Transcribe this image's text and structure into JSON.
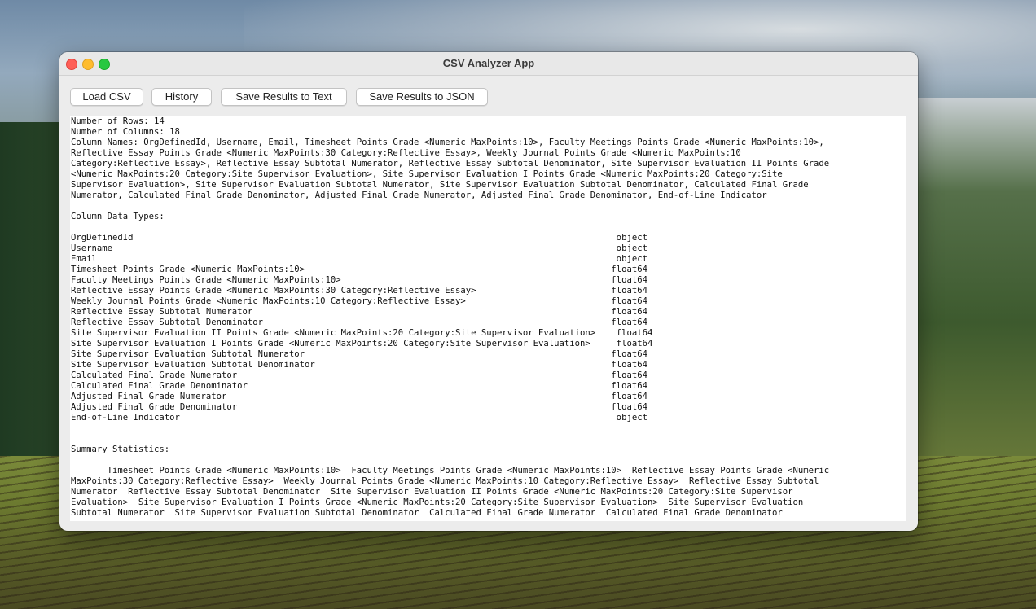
{
  "window": {
    "title": "CSV Analyzer App",
    "controls": {
      "close": "close-icon",
      "minimize": "minimize-icon",
      "maximize": "maximize-icon"
    }
  },
  "toolbar": {
    "load_csv": "Load CSV",
    "history": "History",
    "save_text": "Save Results to Text",
    "save_json": "Save Results to JSON"
  },
  "output_text": "Number of Rows: 14\nNumber of Columns: 18\nColumn Names: OrgDefinedId, Username, Email, Timesheet Points Grade <Numeric MaxPoints:10>, Faculty Meetings Points Grade <Numeric MaxPoints:10>,\nReflective Essay Points Grade <Numeric MaxPoints:30 Category:Reflective Essay>, Weekly Journal Points Grade <Numeric MaxPoints:10\nCategory:Reflective Essay>, Reflective Essay Subtotal Numerator, Reflective Essay Subtotal Denominator, Site Supervisor Evaluation II Points Grade\n<Numeric MaxPoints:20 Category:Site Supervisor Evaluation>, Site Supervisor Evaluation I Points Grade <Numeric MaxPoints:20 Category:Site\nSupervisor Evaluation>, Site Supervisor Evaluation Subtotal Numerator, Site Supervisor Evaluation Subtotal Denominator, Calculated Final Grade\nNumerator, Calculated Final Grade Denominator, Adjusted Final Grade Numerator, Adjusted Final Grade Denominator, End-of-Line Indicator\n\nColumn Data Types:\n\nOrgDefinedId                                                                                             object\nUsername                                                                                                 object\nEmail                                                                                                    object\nTimesheet Points Grade <Numeric MaxPoints:10>                                                           float64\nFaculty Meetings Points Grade <Numeric MaxPoints:10>                                                    float64\nReflective Essay Points Grade <Numeric MaxPoints:30 Category:Reflective Essay>                          float64\nWeekly Journal Points Grade <Numeric MaxPoints:10 Category:Reflective Essay>                            float64\nReflective Essay Subtotal Numerator                                                                     float64\nReflective Essay Subtotal Denominator                                                                   float64\nSite Supervisor Evaluation II Points Grade <Numeric MaxPoints:20 Category:Site Supervisor Evaluation>    float64\nSite Supervisor Evaluation I Points Grade <Numeric MaxPoints:20 Category:Site Supervisor Evaluation>     float64\nSite Supervisor Evaluation Subtotal Numerator                                                           float64\nSite Supervisor Evaluation Subtotal Denominator                                                         float64\nCalculated Final Grade Numerator                                                                        float64\nCalculated Final Grade Denominator                                                                      float64\nAdjusted Final Grade Numerator                                                                          float64\nAdjusted Final Grade Denominator                                                                        float64\nEnd-of-Line Indicator                                                                                    object\n\n\nSummary Statistics:\n\n       Timesheet Points Grade <Numeric MaxPoints:10>  Faculty Meetings Points Grade <Numeric MaxPoints:10>  Reflective Essay Points Grade <Numeric\nMaxPoints:30 Category:Reflective Essay>  Weekly Journal Points Grade <Numeric MaxPoints:10 Category:Reflective Essay>  Reflective Essay Subtotal\nNumerator  Reflective Essay Subtotal Denominator  Site Supervisor Evaluation II Points Grade <Numeric MaxPoints:20 Category:Site Supervisor\nEvaluation>  Site Supervisor Evaluation I Points Grade <Numeric MaxPoints:20 Category:Site Supervisor Evaluation>  Site Supervisor Evaluation\nSubtotal Numerator  Site Supervisor Evaluation Subtotal Denominator  Calculated Final Grade Numerator  Calculated Final Grade Denominator"
}
